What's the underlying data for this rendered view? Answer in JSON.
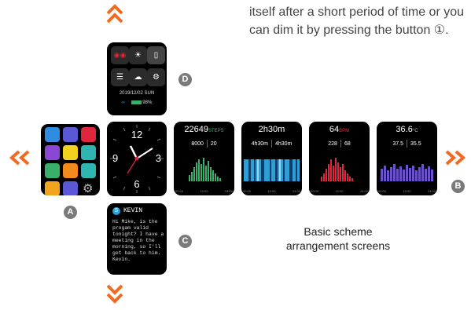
{
  "instructions_text": "itself after a short period of time or you can dim it by pressing the button ①.",
  "caption": "Basic scheme arrangement screens",
  "markers": {
    "a": "A",
    "b": "B",
    "c": "C",
    "d": "D"
  },
  "control_panel": {
    "date": "2019/12/02 SUN",
    "battery": "98%"
  },
  "message": {
    "name": "KEVIN",
    "body": "Hi Mike, is the progam valid tonight? I have a meeting in the morning, so I'll get back to him. Kevin."
  },
  "clock": {
    "n12": "12",
    "n3": "3",
    "n6": "6",
    "n9": "9"
  },
  "steps": {
    "value": "22649",
    "unit": "STEPS",
    "left": "8000",
    "right": "20"
  },
  "sleep": {
    "value": "2h30m",
    "left": "4h30m",
    "right": "4h30m"
  },
  "heart": {
    "value": "64",
    "unit": "BPM",
    "left": "228",
    "right": "68"
  },
  "temp": {
    "value": "36.6",
    "unit": "°C",
    "left": "37.5",
    "right": "35.5"
  },
  "axis": {
    "start": "00:00",
    "mid": "12:00",
    "end": "24:00"
  },
  "colors": {
    "arrow": "#f26a21",
    "marker": "#7a7a7a",
    "steps_bars": "#39b06a",
    "sleep_bars": "#2e9fd6",
    "heart_bars": "#e0263c",
    "temp_bars": "#6b52c9"
  }
}
